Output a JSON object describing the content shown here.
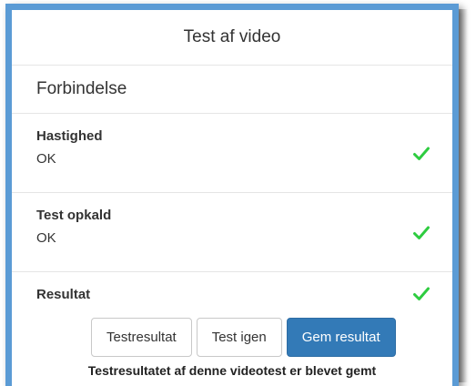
{
  "dialog": {
    "title": "Test af video",
    "section_title": "Forbindelse"
  },
  "rows": [
    {
      "label": "Hastighed",
      "value": "OK",
      "status_icon": "checkmark-icon"
    },
    {
      "label": "Test opkald",
      "value": "OK",
      "status_icon": "checkmark-icon"
    },
    {
      "label": "Resultat",
      "status_icon": "checkmark-icon"
    }
  ],
  "buttons": {
    "test_result": "Testresultat",
    "test_again": "Test igen",
    "save_result": "Gem resultat"
  },
  "message": "Testresultatet af denne videotest er blevet gemt",
  "colors": {
    "accent": "#337ab7",
    "frame_border": "#5b9bd5",
    "success": "#2ecc40"
  }
}
